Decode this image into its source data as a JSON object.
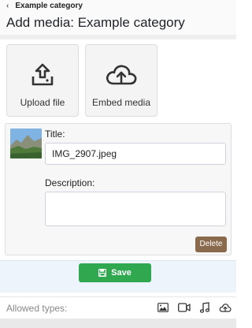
{
  "header": {
    "back_label": "Example category",
    "title": "Add media: Example category"
  },
  "actions": {
    "upload_label": "Upload file",
    "embed_label": "Embed media"
  },
  "media_item": {
    "title_label": "Title:",
    "title_value": "IMG_2907.jpeg",
    "description_label": "Description:",
    "description_value": "",
    "delete_label": "Delete"
  },
  "save": {
    "label": "Save"
  },
  "footer": {
    "allowed_label": "Allowed types:",
    "types": [
      "image-icon",
      "video-icon",
      "audio-icon",
      "cloud-upload-icon"
    ]
  },
  "colors": {
    "save_green": "#2fa84f",
    "delete_brown": "#8a6a4c"
  }
}
